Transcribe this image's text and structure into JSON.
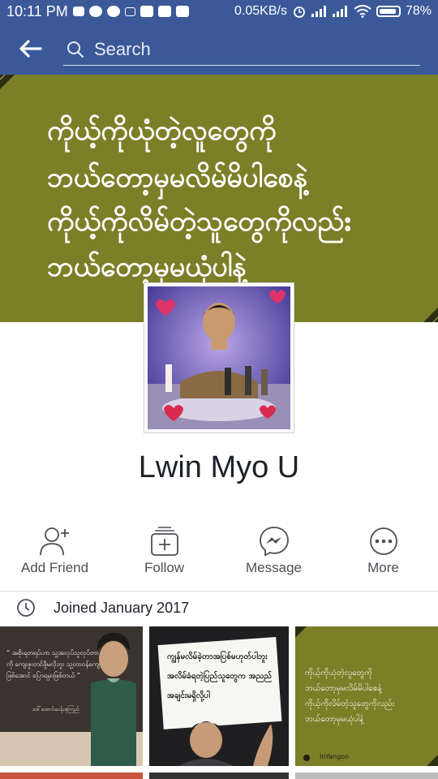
{
  "status_bar": {
    "time": "10:11 PM",
    "network_speed": "0.05KB/s",
    "battery": "78%"
  },
  "app_bar": {
    "search_placeholder": "Search"
  },
  "cover": {
    "lines": [
      "ကိုယ့်ကိုယုံတဲ့လူတွေကို",
      "ဘယ်တော့မှမလိမ်မိပါစေနဲ့",
      "ကိုယ့်ကိုလိမ်တဲ့သူတွေကိုလည်း",
      "ဘယ်တော့မှမယုံပါနဲ့"
    ],
    "background_color": "#7b7f27"
  },
  "profile": {
    "name": "Lwin Myo U"
  },
  "actions": [
    {
      "label": "Add Friend",
      "icon": "add-friend-icon"
    },
    {
      "label": "Follow",
      "icon": "follow-icon"
    },
    {
      "label": "Message",
      "icon": "messenger-icon"
    },
    {
      "label": "More",
      "icon": "more-icon"
    }
  ],
  "about": {
    "joined": "Joined January 2017"
  },
  "photos": {
    "photo1_quote": "“ အစိုးရတရပ်ဟာ သူ့အလုပ်သူလုပ်တာကို ကျေးဇူးတင်ဖို့မလိုဘူး သူ့တာဝန်ကျေ ဖြစ်အောင် ပြောရမှာဖြစ်တယ် ”",
    "photo1_attribution": "ဒေါ်အောင်ဆန်းစုကြည်",
    "photo2_sign": "ကျွန်မလိမ်ခဲ့တာအပြစ်မဟုတ်ပါဘူး အလိမ်ခံရတဲ့ပြည်သူတွေက အညည်အချင်းမရှိလို့ပါ",
    "photo3_lines": [
      "ကိုယ့်ကိုယုံတဲ့လူတွေကို",
      "ဘယ်တော့မှမလိမ်မိပါစေနဲ့",
      "ကိုယ့်ကိုလိမ်တဲ့သူတွေကိုလည်း",
      "ဘယ်တော့မှမယုံပါနဲ့"
    ],
    "photo3_watermark": "InYangon"
  },
  "colors": {
    "facebook_blue": "#3b5998",
    "cover_olive": "#7b7f27"
  }
}
